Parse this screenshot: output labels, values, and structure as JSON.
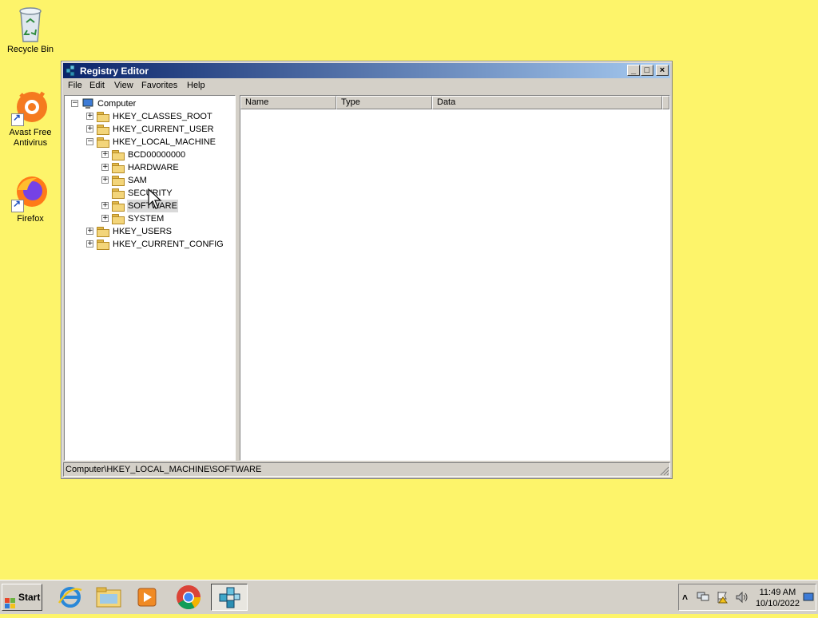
{
  "desktop": {
    "icons": [
      {
        "label": "Recycle Bin",
        "icon": "recycle-bin-icon"
      },
      {
        "label": "Avast Free Antivirus",
        "icon": "avast-icon"
      },
      {
        "label": "Firefox",
        "icon": "firefox-icon"
      }
    ]
  },
  "window": {
    "title": "Registry Editor",
    "menu": [
      "File",
      "Edit",
      "View",
      "Favorites",
      "Help"
    ],
    "tree": [
      {
        "label": "Computer",
        "expander": "−"
      },
      {
        "label": "HKEY_CLASSES_ROOT",
        "expander": "+"
      },
      {
        "label": "HKEY_CURRENT_USER",
        "expander": "+"
      },
      {
        "label": "HKEY_LOCAL_MACHINE",
        "expander": "−"
      },
      {
        "label": "BCD00000000",
        "expander": "+"
      },
      {
        "label": "HARDWARE",
        "expander": "+"
      },
      {
        "label": "SAM",
        "expander": "+"
      },
      {
        "label": "SECURITY",
        "expander": ""
      },
      {
        "label": "SOFTWARE",
        "expander": "+",
        "selected": true
      },
      {
        "label": "SYSTEM",
        "expander": "+"
      },
      {
        "label": "HKEY_USERS",
        "expander": "+"
      },
      {
        "label": "HKEY_CURRENT_CONFIG",
        "expander": "+"
      }
    ],
    "columns": [
      "Name",
      "Type",
      "Data"
    ],
    "status": "Computer\\HKEY_LOCAL_MACHINE\\SOFTWARE"
  },
  "taskbar": {
    "start_label": "Start",
    "quick_launch": [
      "internet-explorer-icon",
      "file-explorer-icon",
      "media-player-icon",
      "chrome-icon",
      "registry-editor-icon"
    ],
    "time": "11:49 AM",
    "date": "10/10/2022"
  },
  "colors": {
    "desktop": "#fdf46a",
    "title_start": "#0a246a",
    "title_end": "#a6caf0"
  }
}
